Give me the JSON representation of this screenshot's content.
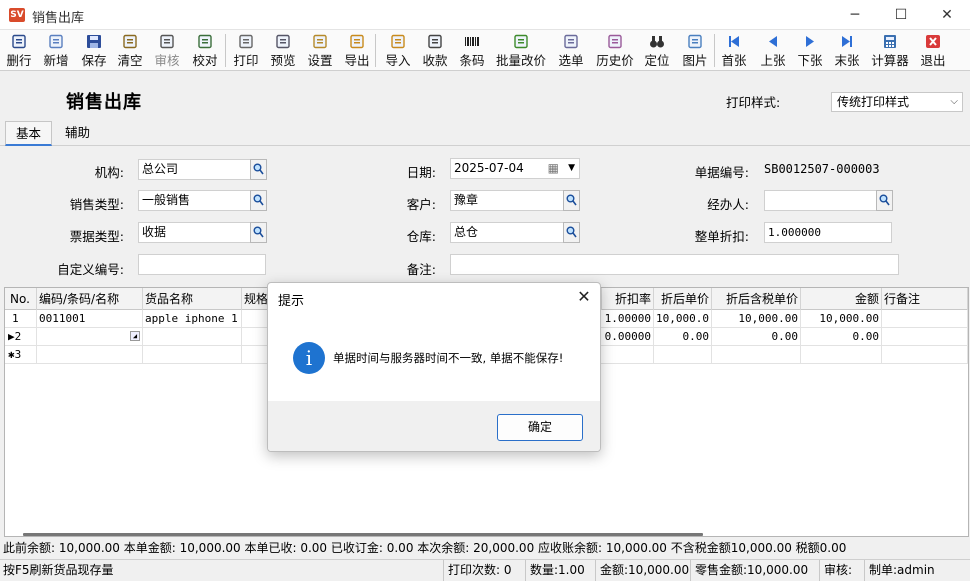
{
  "window": {
    "title": "销售出库",
    "app_icon_text": "SV"
  },
  "toolbar": [
    {
      "label": "删行",
      "icon": "delete-row-icon",
      "enabled": true
    },
    {
      "label": "新增",
      "icon": "new-doc-icon",
      "enabled": true
    },
    {
      "label": "保存",
      "icon": "save-icon",
      "enabled": true
    },
    {
      "label": "清空",
      "icon": "broom-icon",
      "enabled": true
    },
    {
      "label": "审核",
      "icon": "stamp-icon",
      "enabled": false
    },
    {
      "label": "校对",
      "icon": "check-icon",
      "enabled": true
    },
    {
      "label": "打印",
      "icon": "printer-icon",
      "enabled": true
    },
    {
      "label": "预览",
      "icon": "preview-icon",
      "enabled": true
    },
    {
      "label": "设置",
      "icon": "settings-icon",
      "enabled": true
    },
    {
      "label": "导出",
      "icon": "export-icon",
      "enabled": true
    },
    {
      "label": "导入",
      "icon": "import-icon",
      "enabled": true
    },
    {
      "label": "收款",
      "icon": "receipt-icon",
      "enabled": true
    },
    {
      "label": "条码",
      "icon": "barcode-icon",
      "enabled": true
    },
    {
      "label": "批量改价",
      "icon": "batch-price-icon",
      "enabled": true
    },
    {
      "label": "选单",
      "icon": "select-doc-icon",
      "enabled": true
    },
    {
      "label": "历史价",
      "icon": "history-price-icon",
      "enabled": true
    },
    {
      "label": "定位",
      "icon": "binoculars-icon",
      "enabled": true
    },
    {
      "label": "图片",
      "icon": "picture-icon",
      "enabled": true
    },
    {
      "label": "首张",
      "icon": "first-icon",
      "enabled": true
    },
    {
      "label": "上张",
      "icon": "prev-icon",
      "enabled": true
    },
    {
      "label": "下张",
      "icon": "next-icon",
      "enabled": true
    },
    {
      "label": "末张",
      "icon": "last-icon",
      "enabled": true
    },
    {
      "label": "计算器",
      "icon": "calculator-icon",
      "enabled": true
    },
    {
      "label": "退出",
      "icon": "exit-icon",
      "enabled": true
    }
  ],
  "header": {
    "title": "销售出库",
    "print_style_label": "打印样式:",
    "print_style_value": "传统打印样式"
  },
  "tabs": [
    "基本",
    "辅助"
  ],
  "form": {
    "org_label": "机构:",
    "org_value": "总公司",
    "date_label": "日期:",
    "date_value": "2025-07-04",
    "docno_label": "单据编号:",
    "docno_value": "SB0012507-000003",
    "saletype_label": "销售类型:",
    "saletype_value": "一般销售",
    "customer_label": "客户:",
    "customer_value": "豫章",
    "handler_label": "经办人:",
    "handler_value": "",
    "billtype_label": "票据类型:",
    "billtype_value": "收据",
    "warehouse_label": "仓库:",
    "warehouse_value": "总仓",
    "discount_label": "整单折扣:",
    "discount_value": "1.000000",
    "customno_label": "自定义编号:",
    "customno_value": "",
    "remark_label": "备注:",
    "remark_value": ""
  },
  "grid": {
    "columns": [
      "No.",
      "编码/条码/名称",
      "货品名称",
      "规格",
      "折扣率",
      "折后单价",
      "折后含税单价",
      "金额",
      "行备注"
    ],
    "rows": [
      {
        "no": "1",
        "code": "0011001",
        "name": "apple iphone  1",
        "spec": "",
        "rate": "1.00000",
        "price": "10,000.0",
        "taxprice": "10,000.00",
        "amount": "10,000.00",
        "remark": ""
      },
      {
        "no": "▶2",
        "code": "",
        "name": "",
        "spec": "",
        "rate": "0.00000",
        "price": "0.00",
        "taxprice": "0.00",
        "amount": "0.00",
        "remark": ""
      },
      {
        "no": "✱3",
        "code": "",
        "name": "",
        "spec": "",
        "rate": "",
        "price": "",
        "taxprice": "",
        "amount": "",
        "remark": ""
      }
    ]
  },
  "summary": "此前余额: 10,000.00 本单金额: 10,000.00 本单已收: 0.00 已收订金: 0.00 本次余额: 20,000.00 应收账余额: 10,000.00 不含税金额10,000.00 税额0.00",
  "statusbar": {
    "hint": "按F5刷新货品现存量",
    "print_count": "打印次数: 0",
    "quantity": "数量:1.00",
    "amount": "金额:10,000.00",
    "retail_amount": "零售金额:10,000.00",
    "audit": "审核:",
    "creator": "制单:admin"
  },
  "dialog": {
    "title": "提示",
    "message": "单据时间与服务器时间不一致, 单据不能保存!",
    "ok_label": "确定"
  },
  "colors": {
    "accent": "#1e73d0",
    "title_bg": "#ffffff",
    "window_bg": "#f0f0f0"
  }
}
